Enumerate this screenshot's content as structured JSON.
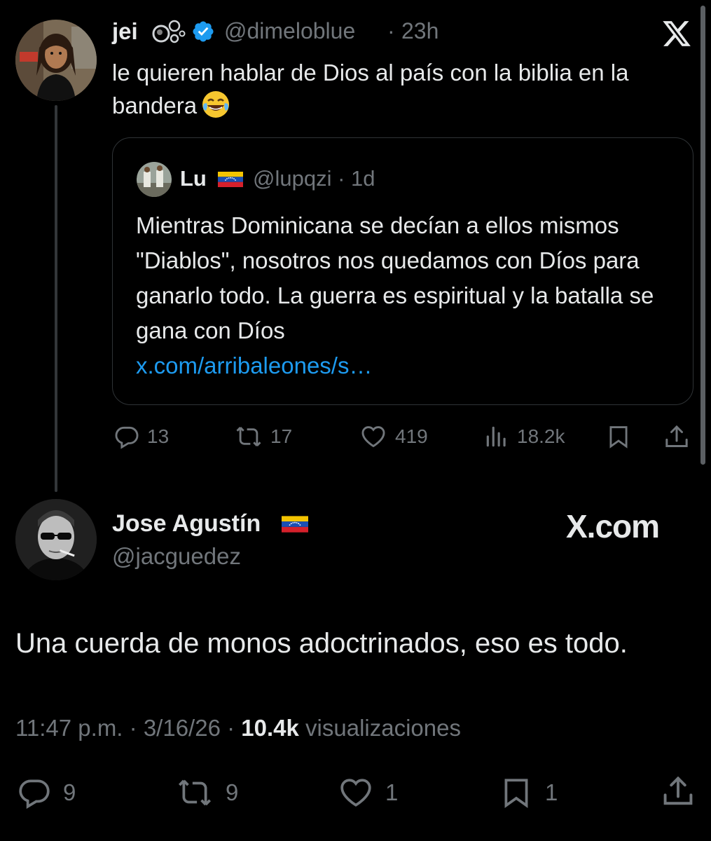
{
  "tweet1": {
    "name": "jei",
    "handle": "@dimeloblue",
    "separator": "·",
    "time": "23h",
    "text": "le quieren hablar de Dios al país con la biblia en la bandera",
    "emoji": "laughing-tears",
    "quote": {
      "name": "Lu",
      "handle": "@lupqzi",
      "separator": "·",
      "time": "1d",
      "text": "Mientras Dominicana se decían a ellos mismos \"Diablos\", nosotros nos quedamos con Díos para ganarlo todo. La guerra es espiritual y la batalla se gana con Díos",
      "link": "x.com/arribaleones/s…"
    },
    "actions": {
      "replies": "13",
      "reposts": "17",
      "likes": "419",
      "views": "18.2k"
    }
  },
  "reply": {
    "name": "Jose Agustín",
    "handle": "@jacguedez",
    "watermark": "X.com",
    "text": "Una cuerda de monos adoctrinados, eso es todo.",
    "time": "11:47 p.m.",
    "sep1": "·",
    "date": "3/16/26",
    "sep2": "·",
    "views_count": "10.4k",
    "views_label": "visualizaciones",
    "actions": {
      "replies": "9",
      "reposts": "9",
      "likes": "1",
      "bookmarks": "1"
    }
  },
  "colors": {
    "background": "#000000",
    "text": "#e7e9ea",
    "muted": "#71767b",
    "link": "#1d9bf0",
    "verified": "#1d9bf0",
    "border": "#2f3336"
  }
}
